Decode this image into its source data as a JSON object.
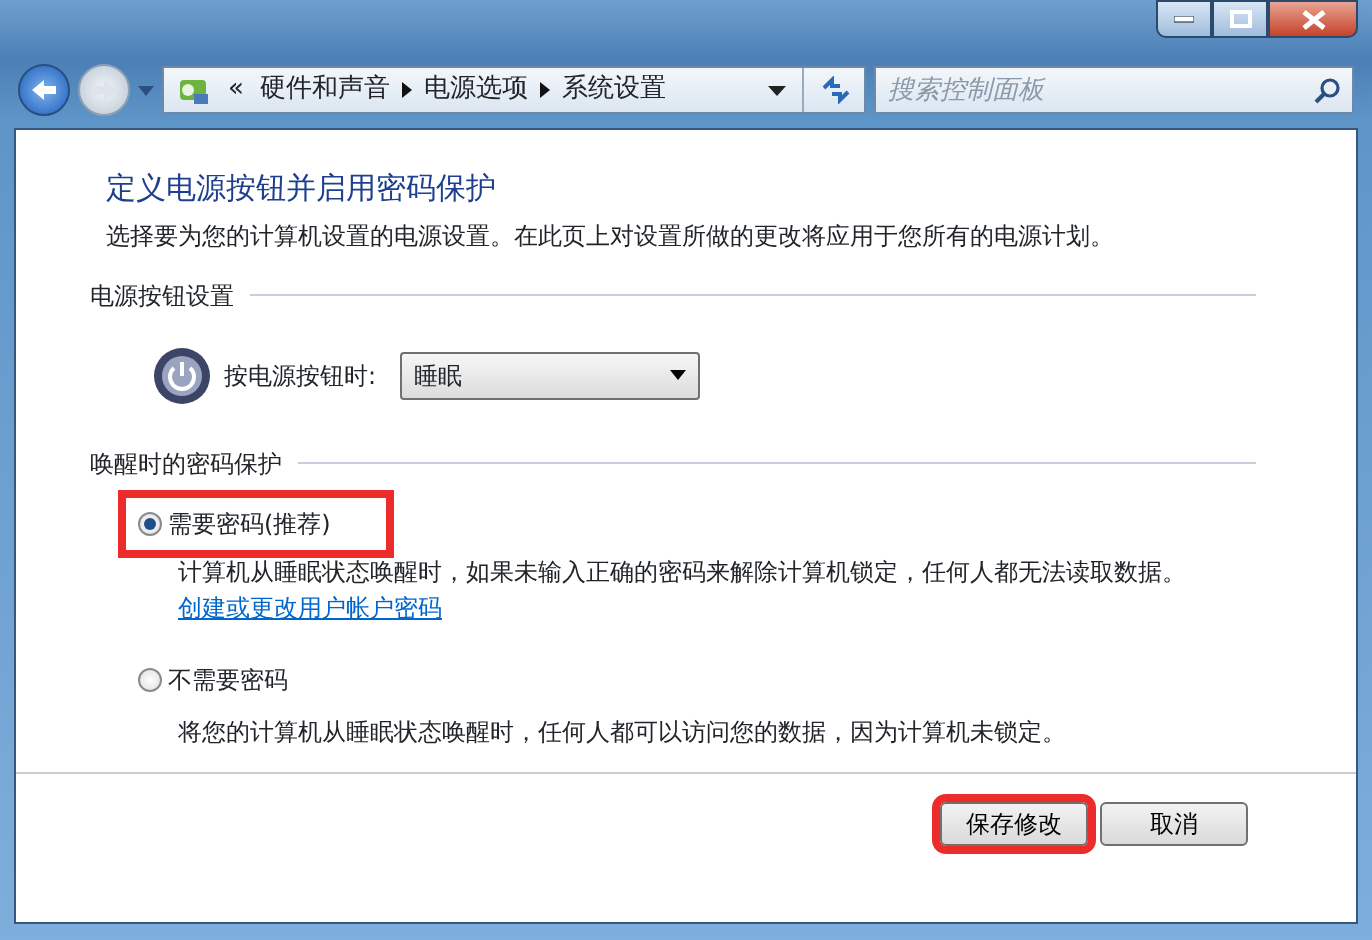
{
  "breadcrumb": {
    "overflow": "«",
    "items": [
      "硬件和声音",
      "电源选项",
      "系统设置"
    ]
  },
  "search": {
    "placeholder": "搜索控制面板"
  },
  "title": "定义电源按钮并启用密码保护",
  "description": "选择要为您的计算机设置的电源设置。在此页上对设置所做的更改将应用于您所有的电源计划。",
  "power_section": {
    "heading": "电源按钮设置",
    "label": "按电源按钮时:",
    "value": "睡眠"
  },
  "password_section": {
    "heading": "唤醒时的密码保护",
    "options": [
      {
        "label": "需要密码(推荐)",
        "selected": true,
        "highlighted": true,
        "description": "计算机从睡眠状态唤醒时，如果未输入正确的密码来解除计算机锁定，任何人都无法读取数据。",
        "link": "创建或更改用户帐户密码"
      },
      {
        "label": "不需要密码",
        "selected": false,
        "highlighted": false,
        "description": "将您的计算机从睡眠状态唤醒时，任何人都可以访问您的数据，因为计算机未锁定。"
      }
    ]
  },
  "buttons": [
    {
      "label": "保存修改",
      "highlighted": true
    },
    {
      "label": "取消",
      "highlighted": false
    }
  ]
}
